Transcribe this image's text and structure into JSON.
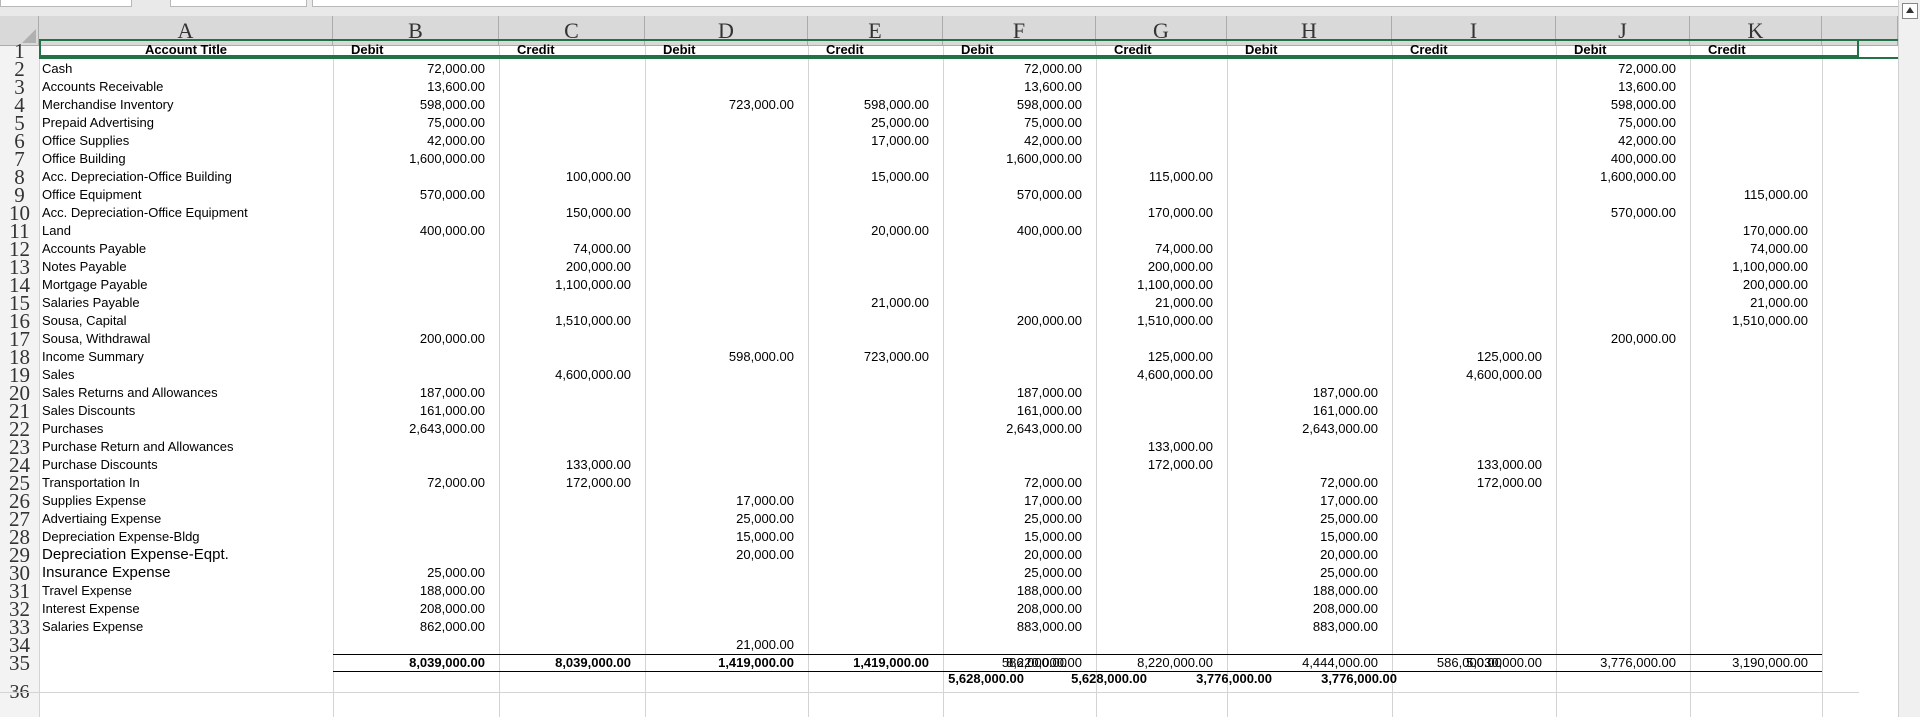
{
  "columns": [
    "A",
    "B",
    "C",
    "D",
    "E",
    "F",
    "G",
    "H",
    "I",
    "J",
    "K"
  ],
  "header": {
    "account_title": "Account Title",
    "labels": [
      "Debit",
      "Credit",
      "Debit",
      "Credit",
      "Debit",
      "Credit",
      "Debit",
      "Credit",
      "Debit",
      "Credit"
    ]
  },
  "rows": [
    {
      "n": "2",
      "title": "Cash",
      "B": "72,000.00",
      "F": "72,000.00",
      "J": "72,000.00"
    },
    {
      "n": "3",
      "title": "Accounts Receivable",
      "B": "13,600.00",
      "F": "13,600.00",
      "J": "13,600.00"
    },
    {
      "n": "4",
      "title": "Merchandise Inventory",
      "B": "598,000.00",
      "D": "723,000.00",
      "E": "598,000.00",
      "F": "598,000.00",
      "J": "598,000.00"
    },
    {
      "n": "5",
      "title": "Prepaid Advertising",
      "B": "75,000.00",
      "E": "25,000.00",
      "F": "75,000.00",
      "J": "75,000.00"
    },
    {
      "n": "6",
      "title": "Office Supplies",
      "B": "42,000.00",
      "E": "17,000.00",
      "F": "42,000.00",
      "J": "42,000.00"
    },
    {
      "n": "7",
      "title": "Office Building",
      "B": "1,600,000.00",
      "F": "1,600,000.00",
      "J": "400,000.00"
    },
    {
      "n": "8",
      "title": "Acc. Depreciation-Office Building",
      "C": "100,000.00",
      "E": "15,000.00",
      "G": "115,000.00",
      "J": "1,600,000.00"
    },
    {
      "n": "9",
      "title": "Office Equipment",
      "B": "570,000.00",
      "F": "570,000.00",
      "K": "115,000.00"
    },
    {
      "n": "10",
      "title": "Acc. Depreciation-Office Equipment",
      "C": "150,000.00",
      "G": "170,000.00",
      "J": "570,000.00"
    },
    {
      "n": "11",
      "title": "Land",
      "B": "400,000.00",
      "E": "20,000.00",
      "F": "400,000.00",
      "K": "170,000.00"
    },
    {
      "n": "12",
      "title": "Accounts Payable",
      "C": "74,000.00",
      "G": "74,000.00",
      "K": "74,000.00"
    },
    {
      "n": "13",
      "title": "Notes Payable",
      "C": "200,000.00",
      "G": "200,000.00",
      "K": "1,100,000.00"
    },
    {
      "n": "14",
      "title": "Mortgage Payable",
      "C": "1,100,000.00",
      "G": "1,100,000.00",
      "K": "200,000.00"
    },
    {
      "n": "15",
      "title": "Salaries Payable",
      "E": "21,000.00",
      "G": "21,000.00",
      "K": "21,000.00"
    },
    {
      "n": "16",
      "title": "Sousa, Capital",
      "C": "1,510,000.00",
      "F": "200,000.00",
      "G": "1,510,000.00",
      "K": "1,510,000.00"
    },
    {
      "n": "17",
      "title": "Sousa, Withdrawal",
      "B": "200,000.00",
      "J": "200,000.00"
    },
    {
      "n": "18",
      "title": "Income Summary",
      "D": "598,000.00",
      "E": "723,000.00",
      "G": "125,000.00",
      "I": "125,000.00"
    },
    {
      "n": "19",
      "title": "Sales",
      "C": "4,600,000.00",
      "G": "4,600,000.00",
      "I": "4,600,000.00"
    },
    {
      "n": "20",
      "title": "Sales Returns and Allowances",
      "B": "187,000.00",
      "F": "187,000.00",
      "H": "187,000.00"
    },
    {
      "n": "21",
      "title": "Sales Discounts",
      "B": "161,000.00",
      "F": "161,000.00",
      "H": "161,000.00"
    },
    {
      "n": "22",
      "title": "Purchases",
      "B": "2,643,000.00",
      "F": "2,643,000.00",
      "H": "2,643,000.00"
    },
    {
      "n": "23",
      "title": "Purchase Return and Allowances",
      "G": "133,000.00"
    },
    {
      "n": "24",
      "title": "Purchase Discounts",
      "C": "133,000.00",
      "G": "172,000.00",
      "I": "133,000.00"
    },
    {
      "n": "25",
      "title": "Transportation In",
      "B": "72,000.00",
      "C": "172,000.00",
      "F": "72,000.00",
      "H": "72,000.00",
      "I": "172,000.00"
    },
    {
      "n": "26",
      "title": "Supplies Expense",
      "D": "17,000.00",
      "F": "17,000.00",
      "H": "17,000.00"
    },
    {
      "n": "27",
      "title": "Advertiaing Expense",
      "D": "25,000.00",
      "F": "25,000.00",
      "H": "25,000.00"
    },
    {
      "n": "28",
      "title": "Depreciation Expense-Bldg",
      "D": "15,000.00",
      "F": "15,000.00",
      "H": "15,000.00"
    },
    {
      "n": "29",
      "title": "Depreciation Expense-Eqpt.",
      "big": true,
      "D": "20,000.00",
      "F": "20,000.00",
      "H": "20,000.00"
    },
    {
      "n": "30",
      "title": "Insurance Expense",
      "big": true,
      "B": "25,000.00",
      "F": "25,000.00",
      "H": "25,000.00"
    },
    {
      "n": "31",
      "title": "Travel Expense",
      "B": "188,000.00",
      "F": "188,000.00",
      "H": "188,000.00"
    },
    {
      "n": "32",
      "title": "Interest Expense",
      "B": "208,000.00",
      "F": "208,000.00",
      "H": "208,000.00"
    },
    {
      "n": "33",
      "title": "Salaries Expense",
      "B": "862,000.00",
      "F": "883,000.00",
      "H": "883,000.00"
    },
    {
      "n": "34",
      "title": "",
      "D": "21,000.00"
    }
  ],
  "totals": {
    "n": "35",
    "B": "8,039,000.00",
    "C": "8,039,000.00",
    "D": "1,419,000.00",
    "E": "1,419,000.00",
    "F": "8,220,000.00",
    "G": "8,220,000.00",
    "H": "4,444,000.00",
    "I": "5,030,000.00",
    "J": "3,776,000.00",
    "K": "3,190,000.00"
  },
  "row36": {
    "n": "36",
    "net_income_1": "586,000.00",
    "net_income_2": "586,000.00",
    "final_1": "5,628,000.00",
    "final_2": "5,628,000.00",
    "final_3": "3,776,000.00",
    "final_4": "3,776,000.00"
  },
  "colors": {
    "header_bg": "#d9d9d9",
    "grid": "#d4d4d4",
    "selection": "#217346"
  }
}
